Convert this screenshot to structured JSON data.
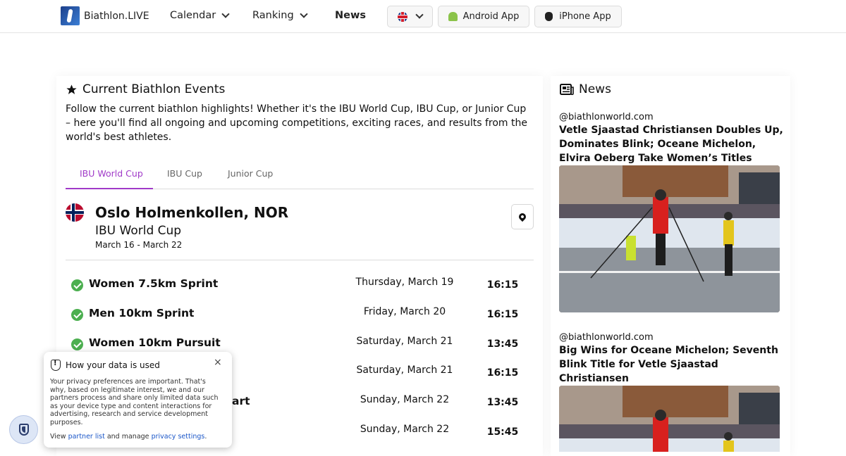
{
  "header": {
    "brand": "Biathlon.LIVE",
    "nav": [
      "Calendar",
      "Ranking",
      "News"
    ],
    "language_icon": "uk-flag-icon",
    "android_app": "Android App",
    "iphone_app": "iPhone App"
  },
  "events": {
    "title": "Current Biathlon Events",
    "intro": "Follow the current biathlon highlights! Whether it's the IBU World Cup, IBU Cup, or Junior Cup – here you'll find all ongoing and upcoming competitions, exciting races, and results from the world's best athletes.",
    "tabs": [
      "IBU World Cup",
      "IBU Cup",
      "Junior Cup"
    ],
    "active_tab": "IBU World Cup",
    "event": {
      "location": "Oslo Holmenkollen, NOR",
      "series": "IBU World Cup",
      "dates": "March 16 - March 22"
    },
    "races": [
      {
        "name": "Women 7.5km Sprint",
        "date": "Thursday, March 19",
        "time": "16:15"
      },
      {
        "name": "Men 10km Sprint",
        "date": "Friday, March 20",
        "time": "16:15"
      },
      {
        "name": "Women 10km Pursuit",
        "date": "Saturday, March 21",
        "time": "13:45"
      },
      {
        "name": "",
        "date": "Saturday, March 21",
        "time": "16:15"
      },
      {
        "name": "art",
        "date": "Sunday, March 22",
        "time": "13:45"
      },
      {
        "name": "",
        "date": "Sunday, March 22",
        "time": "15:45"
      }
    ]
  },
  "news": {
    "title": "News",
    "items": [
      {
        "source": "@biathlonworld.com",
        "headline": "Vetle Sjaastad Christiansen Doubles Up, Dominates Blink; Oceane Michelon, Elvira Oeberg Take Women’s Titles"
      },
      {
        "source": "@biathlonworld.com",
        "headline": "Big Wins for Oceane Michelon; Seventh Blink Title for Vetle Sjaastad Christiansen"
      }
    ]
  },
  "consent": {
    "title": "How your data is used",
    "body": "Your privacy preferences are important. That's why, based on legitimate interest, we and our partners process and share only limited data such as your device type and content interactions for advertising, research and service development purposes.",
    "links_prefix": "View",
    "partner_link": "partner list",
    "links_middle": "and manage",
    "settings_link": "privacy settings",
    "links_suffix": ".",
    "close": "×"
  }
}
